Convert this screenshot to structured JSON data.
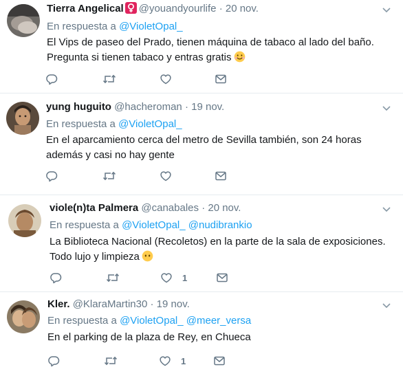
{
  "colors": {
    "link": "#1da1f2",
    "muted": "#657786",
    "text": "#14171a",
    "divider": "#e6ecf0",
    "badge": "#e0245e"
  },
  "reply_prefix": "En respuesta a",
  "tweets": [
    {
      "name": "Tierra Angelical",
      "name_badge_icon": "female-sign-icon",
      "handle": "@youandyourlife",
      "dot": "·",
      "time": "20 nov.",
      "mentions": [
        "@VioletOpal_"
      ],
      "text": "El Vips de paseo del Prado, tienen máquina de tabaco al lado del baño. Pregunta si tienen tabaco y entras gratis",
      "emoji": "smiling-face-with-hearts-emoji",
      "likes": ""
    },
    {
      "name": "yung huguito",
      "handle": "@hacheroman",
      "dot": "·",
      "time": "19 nov.",
      "mentions": [
        "@VioletOpal_"
      ],
      "text": "En el aparcamiento cerca del metro de Sevilla también, son 24 horas además y casi no hay gente",
      "likes": ""
    },
    {
      "name": "viole(n)ta Palmera",
      "handle": "@canabales",
      "dot": "·",
      "time": "20 nov.",
      "mentions": [
        "@VioletOpal_",
        "@nudibrankio"
      ],
      "text": "La Biblioteca  Nacional (Recoletos) en la parte de la sala de exposiciones. Todo lujo y limpieza",
      "emoji": "face-without-mouth-emoji",
      "likes": "1"
    },
    {
      "name": "Kler.",
      "handle": "@KlaraMartin30",
      "dot": "·",
      "time": "19 nov.",
      "mentions": [
        "@VioletOpal_",
        "@meer_versa"
      ],
      "text": "En el parking de la plaza de Rey, en Chueca",
      "likes": "1"
    }
  ]
}
